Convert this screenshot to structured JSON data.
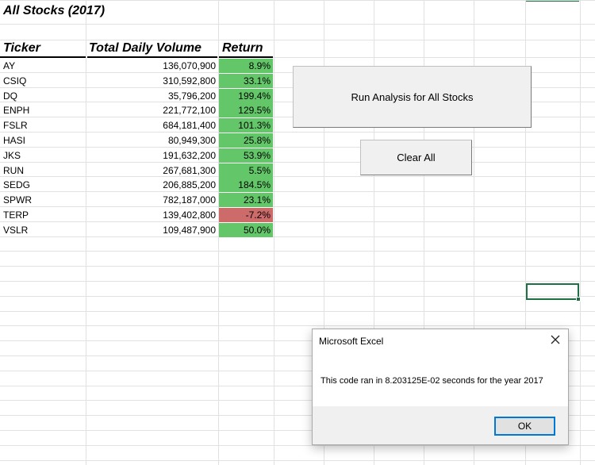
{
  "sheet": {
    "title": "All Stocks (2017)",
    "headers": {
      "ticker": "Ticker",
      "volume": "Total Daily Volume",
      "return": "Return"
    },
    "rows": [
      {
        "ticker": "AY",
        "volume": "136,070,900",
        "return": "8.9%",
        "positive": true
      },
      {
        "ticker": "CSIQ",
        "volume": "310,592,800",
        "return": "33.1%",
        "positive": true
      },
      {
        "ticker": "DQ",
        "volume": "35,796,200",
        "return": "199.4%",
        "positive": true
      },
      {
        "ticker": "ENPH",
        "volume": "221,772,100",
        "return": "129.5%",
        "positive": true
      },
      {
        "ticker": "FSLR",
        "volume": "684,181,400",
        "return": "101.3%",
        "positive": true
      },
      {
        "ticker": "HASI",
        "volume": "80,949,300",
        "return": "25.8%",
        "positive": true
      },
      {
        "ticker": "JKS",
        "volume": "191,632,200",
        "return": "53.9%",
        "positive": true
      },
      {
        "ticker": "RUN",
        "volume": "267,681,300",
        "return": "5.5%",
        "positive": true
      },
      {
        "ticker": "SEDG",
        "volume": "206,885,200",
        "return": "184.5%",
        "positive": true
      },
      {
        "ticker": "SPWR",
        "volume": "782,187,000",
        "return": "23.1%",
        "positive": true
      },
      {
        "ticker": "TERP",
        "volume": "139,402,800",
        "return": "-7.2%",
        "positive": false
      },
      {
        "ticker": "VSLR",
        "volume": "109,487,900",
        "return": "50.0%",
        "positive": true
      }
    ]
  },
  "buttons": {
    "run_label": "Run Analysis for All Stocks",
    "clear_label": "Clear All"
  },
  "dialog": {
    "title": "Microsoft Excel",
    "message": "This code ran in 8.203125E-02 seconds for the year 2017",
    "ok_label": "OK",
    "close_icon": "close-icon"
  },
  "colors": {
    "positive_fill": "#63c769",
    "negative_fill": "#cd6a6a",
    "selection": "#1e7145",
    "dialog_focus": "#0078d7"
  }
}
